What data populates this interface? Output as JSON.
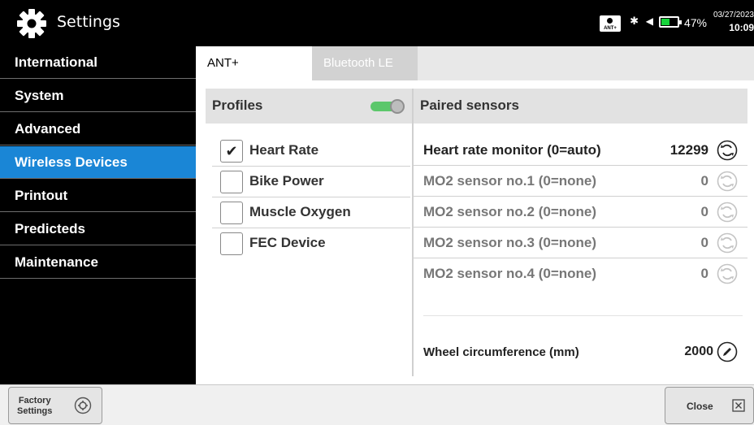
{
  "header": {
    "title": "Settings",
    "ant_label": "ANT+",
    "battery_percent": "47%",
    "battery_level": 0.47,
    "date": "03/27/2023",
    "time": "10:09"
  },
  "sidebar": {
    "items": [
      {
        "label": "International",
        "active": false
      },
      {
        "label": "System",
        "active": false
      },
      {
        "label": "Advanced",
        "active": false
      },
      {
        "label": "Wireless Devices",
        "active": true
      },
      {
        "label": "Printout",
        "active": false
      },
      {
        "label": "Predicteds",
        "active": false
      },
      {
        "label": "Maintenance",
        "active": false
      }
    ]
  },
  "tabs": [
    {
      "label": "ANT+",
      "active": true
    },
    {
      "label": "Bluetooth LE",
      "active": false
    }
  ],
  "profiles": {
    "title": "Profiles",
    "toggle_on": true,
    "items": [
      {
        "label": "Heart Rate",
        "checked": true
      },
      {
        "label": "Bike Power",
        "checked": false
      },
      {
        "label": "Muscle Oxygen",
        "checked": false
      },
      {
        "label": "FEC Device",
        "checked": false
      }
    ]
  },
  "sensors": {
    "title": "Paired sensors",
    "items": [
      {
        "label": "Heart rate monitor (0=auto)",
        "value": "12299",
        "enabled": true
      },
      {
        "label": "MO2 sensor no.1 (0=none)",
        "value": "0",
        "enabled": false
      },
      {
        "label": "MO2 sensor no.2 (0=none)",
        "value": "0",
        "enabled": false
      },
      {
        "label": "MO2 sensor no.3 (0=none)",
        "value": "0",
        "enabled": false
      },
      {
        "label": "MO2 sensor no.4 (0=none)",
        "value": "0",
        "enabled": false
      }
    ],
    "wheel": {
      "label": "Wheel circumference (mm)",
      "value": "2000"
    }
  },
  "footer": {
    "factory_line1": "Factory",
    "factory_line2": "Settings",
    "close_label": "Close"
  },
  "colors": {
    "accent": "#1a86d6",
    "toggle": "#5cc76b",
    "battery": "#17d43b"
  }
}
